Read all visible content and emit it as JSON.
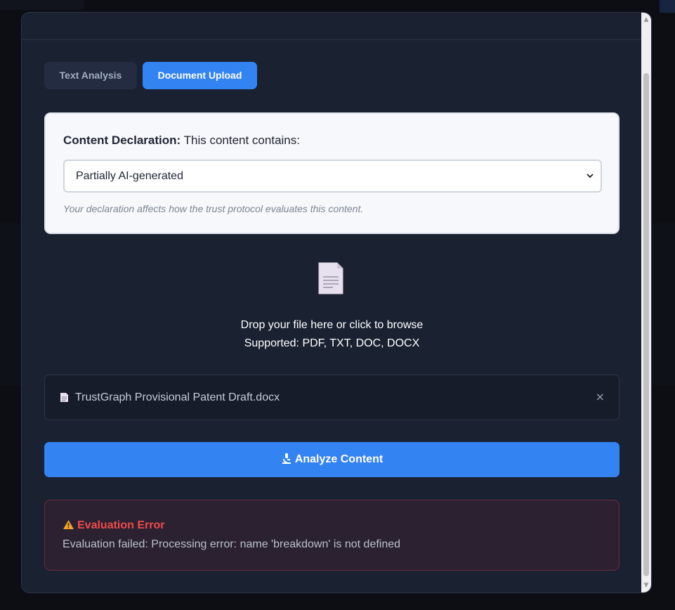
{
  "tabs": {
    "text_analysis": "Text Analysis",
    "document_upload": "Document Upload"
  },
  "declaration": {
    "title_bold": "Content Declaration:",
    "title_rest": "This content contains:",
    "selected": "Partially AI-generated",
    "note": "Your declaration affects how the trust protocol evaluates this content."
  },
  "drop_zone": {
    "line1": "Drop your file here or click to browse",
    "line2": "Supported: PDF, TXT, DOC, DOCX"
  },
  "file": {
    "name": "TrustGraph Provisional Patent Draft.docx",
    "remove": "×"
  },
  "analyze_button": "Analyze Content",
  "error": {
    "title": "Evaluation Error",
    "message": "Evaluation failed: Processing error: name 'breakdown' is not defined"
  },
  "colors": {
    "accent": "#3483f3",
    "error": "#ef4b4b",
    "modal_bg": "#1a2131"
  }
}
